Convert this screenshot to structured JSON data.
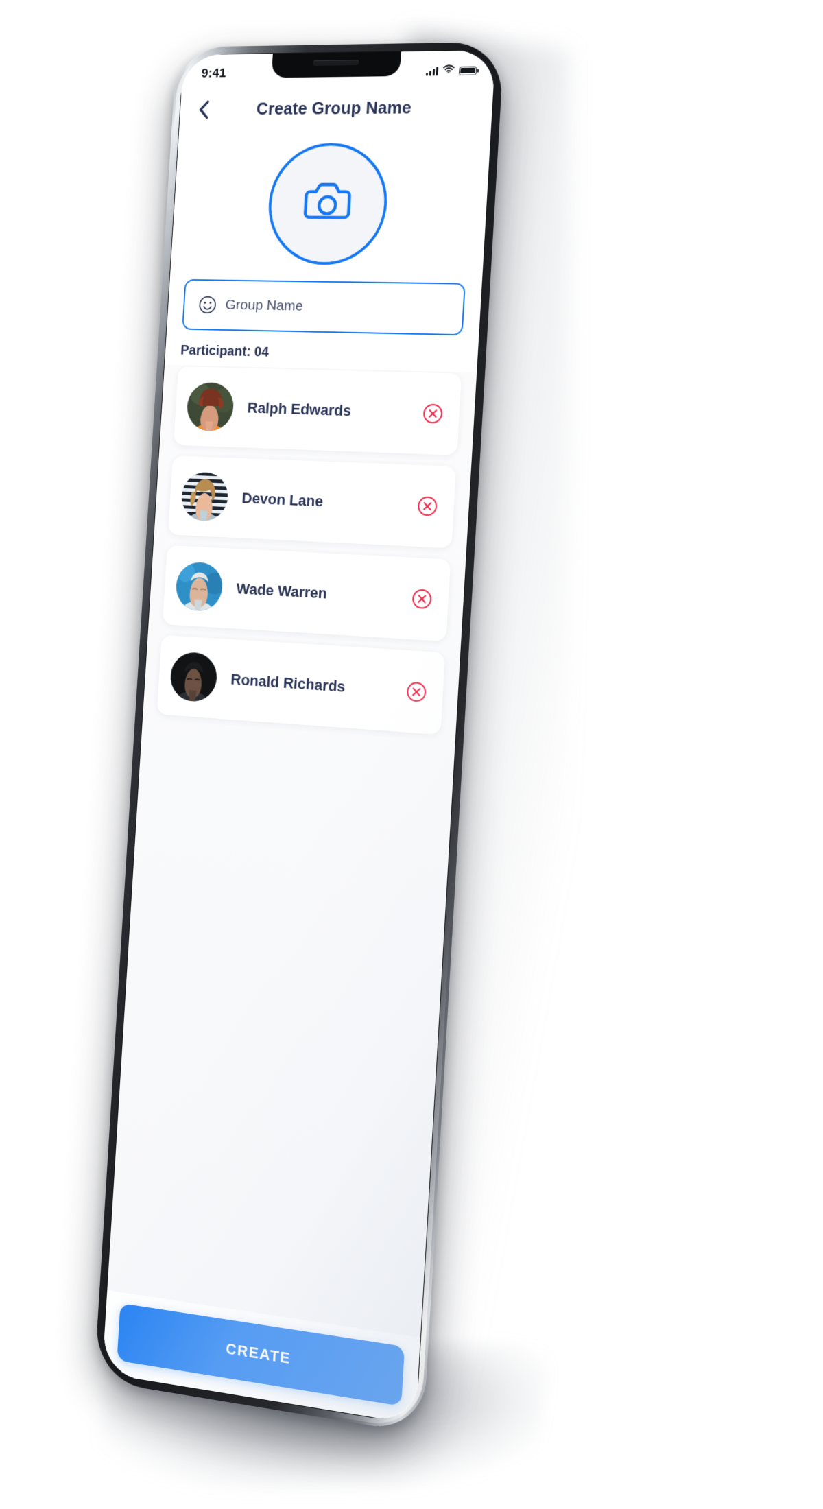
{
  "status_bar": {
    "time": "9:41",
    "signal_icon": "cellular-signal-icon",
    "wifi_icon": "wifi-icon",
    "battery_icon": "battery-full-icon",
    "signal_bars": 4,
    "battery_level": 100
  },
  "appbar": {
    "back_icon": "chevron-left-icon",
    "title": "Create Group Name"
  },
  "avatar": {
    "icon": "camera-icon",
    "ring_color": "#1578f2",
    "fill_color": "#f3f5f8"
  },
  "group_name_field": {
    "icon": "smiley-face-icon",
    "value": "",
    "placeholder": "Group Name",
    "border_color": "#1578f2"
  },
  "participants": {
    "label": "Participant: 04",
    "count": "04",
    "remove_icon": "circle-x-icon",
    "remove_color": "#f0294a",
    "items": [
      {
        "name": "Ralph Edwards",
        "avatar": "woman-orange-jacket-photo"
      },
      {
        "name": "Devon Lane",
        "avatar": "woman-striped-background-photo"
      },
      {
        "name": "Wade Warren",
        "avatar": "elderly-man-blue-background-photo"
      },
      {
        "name": "Ronald Richards",
        "avatar": "man-dark-background-photo"
      }
    ]
  },
  "cta": {
    "label": "CREATE",
    "color": "#1578f2"
  },
  "theme": {
    "accent": "#1578f2",
    "text_dark": "#2b3557",
    "danger": "#f0294a",
    "screen_bg": "#ffffff"
  }
}
